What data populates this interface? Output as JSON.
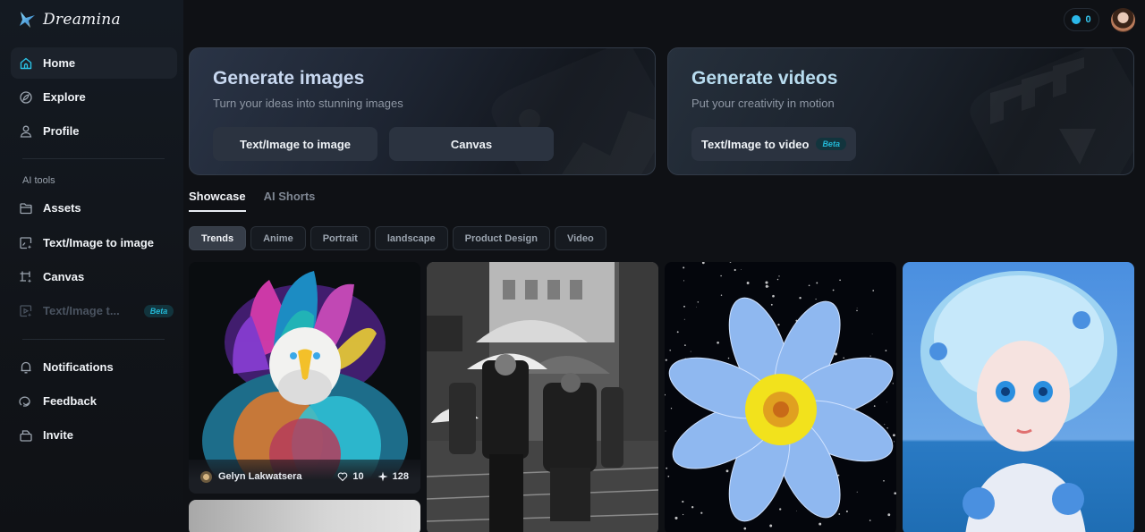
{
  "app": {
    "name": "Dreamina"
  },
  "sidebar": {
    "main_items": [
      {
        "label": "Home",
        "icon": "home-icon",
        "active": true
      },
      {
        "label": "Explore",
        "icon": "explore-icon"
      },
      {
        "label": "Profile",
        "icon": "profile-icon"
      }
    ],
    "section_label": "AI tools",
    "tool_items": [
      {
        "label": "Assets",
        "icon": "folder-icon"
      },
      {
        "label": "Text/Image to image",
        "icon": "image-sparkle-icon"
      },
      {
        "label": "Canvas",
        "icon": "canvas-crop-icon"
      },
      {
        "label": "Text/Image t...",
        "icon": "video-sparkle-icon",
        "badge": "Beta",
        "disabled": true
      }
    ],
    "bottom_items": [
      {
        "label": "Notifications",
        "icon": "bell-icon"
      },
      {
        "label": "Feedback",
        "icon": "feedback-icon"
      },
      {
        "label": "Invite",
        "icon": "invite-icon"
      }
    ]
  },
  "header": {
    "credits": "0",
    "credits_icon": "credit-coin-icon",
    "avatar": "user-avatar"
  },
  "hero": {
    "images": {
      "title": "Generate images",
      "subtitle": "Turn your ideas into stunning images",
      "buttons": [
        "Text/Image to image",
        "Canvas"
      ]
    },
    "videos": {
      "title": "Generate videos",
      "subtitle": "Put your creativity in motion",
      "button": "Text/Image to video",
      "badge": "Beta"
    }
  },
  "tabs": [
    {
      "label": "Showcase",
      "active": true
    },
    {
      "label": "AI Shorts"
    }
  ],
  "filters": [
    {
      "label": "Trends",
      "active": true
    },
    {
      "label": "Anime"
    },
    {
      "label": "Portrait"
    },
    {
      "label": "landscape"
    },
    {
      "label": "Product Design"
    },
    {
      "label": "Video"
    }
  ],
  "gallery": [
    {
      "subject": "rainbow-feathered eagle",
      "author": "Gelyn Lakwatsera",
      "likes": "10",
      "remixes": "128"
    },
    {
      "subject": "black and white couple with umbrellas in rain"
    },
    {
      "subject": "blue flower on starry background"
    },
    {
      "subject": "anime girl with blue curly hair by the sea"
    },
    {
      "subject": "grey gradient image (partially visible)"
    }
  ],
  "colors": {
    "accent": "#23b8d6",
    "background": "#0f1115",
    "beta_bg": "#12343d"
  }
}
